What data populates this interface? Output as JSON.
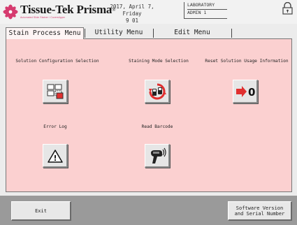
{
  "header": {
    "brand_name": "Tissue-Tek Prisma",
    "brand_mark": "®",
    "brand_tagline": "Automated Slide Stainer / Coverslipper",
    "date": "2017, April 7, Friday",
    "time": "9 01",
    "department": "LABORATORY",
    "user": "ADMIN 1",
    "lock_icon": "lock-icon"
  },
  "tabs": [
    {
      "label": "Stain Process Menu",
      "active": true
    },
    {
      "label": "Utility Menu",
      "active": false
    },
    {
      "label": "Edit Menu",
      "active": false
    }
  ],
  "functions": [
    {
      "label": "Solution Configuration Selection",
      "icon": "solution-grid-icon"
    },
    {
      "label": "Staining Mode Selection",
      "icon": "staining-mode-icon"
    },
    {
      "label": "Reset Solution Usage Information",
      "icon": "reset-arrow-zero-icon",
      "glyph": "0"
    },
    {
      "label": "Error Log",
      "icon": "warning-icon",
      "glyph": "!"
    },
    {
      "label": "Read Barcode",
      "icon": "barcode-scanner-icon"
    }
  ],
  "footer": {
    "exit_label": "Exit",
    "version_label": "Software Version\nand Serial Number"
  },
  "colors": {
    "panel_bg": "#fbd0d0",
    "footer_bg": "#9a9a9a",
    "accent_red": "#e03030",
    "logo_pink": "#d63b6f"
  }
}
